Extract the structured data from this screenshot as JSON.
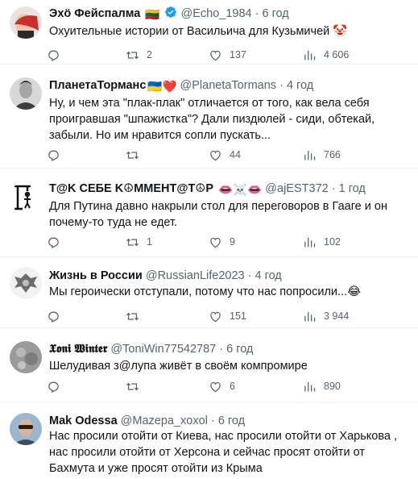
{
  "tweets": [
    {
      "name": "Эхӧ Фейспалма",
      "badges": "🇱🇹",
      "verified": true,
      "handle": "@Echo_1984",
      "dot": "·",
      "time": "6 год",
      "text": "Охуительные истории от Васильича для Кузьмичей 🤡",
      "replies": "",
      "retweets": "2",
      "likes": "137",
      "views": "4 606",
      "avatar": "facepalm-avatar"
    },
    {
      "name": "ПланетаТорманс",
      "badges": "🇺🇦❤️",
      "verified": false,
      "handle": "@PlanetaTormans",
      "dot": "·",
      "time": "4 год",
      "text": "Ну, и чем эта \"плак-плак\" отличается от того, как вела себя проигравшая \"шпажистка\"? Дали пиздюлей - сиди, обтекай, забыли. Но им нравится сопли пускать...",
      "replies": "",
      "retweets": "",
      "likes": "44",
      "views": "766",
      "avatar": "man-portrait-avatar"
    },
    {
      "name": "T@K CEБE K☮MMEHT@T☮P",
      "badges": "👄☠️👄",
      "verified": false,
      "handle": "@ajEST372",
      "dot": "·",
      "time": "1 год",
      "text": "Для Путина давно накрыли стол для переговоров в Гааге и он почему-то туда не едет.",
      "replies": "",
      "retweets": "1",
      "likes": "9",
      "views": "102",
      "avatar": "gallows-avatar"
    },
    {
      "name": "Жизнь в России",
      "badges": "",
      "verified": false,
      "handle": "@RussianLife2023",
      "dot": "·",
      "time": "4 год",
      "text": "Мы героически отступали, потому что нас попросили...😂",
      "replies": "",
      "retweets": "",
      "likes": "151",
      "views": "3 944",
      "avatar": "eagle-emblem-avatar"
    },
    {
      "name": "𝖃𝖔𝖓𝖎 𝖂𝖎𝖓𝖙𝖊𝖗",
      "badges": "",
      "verified": false,
      "handle": "@ToniWin77542787",
      "dot": "·",
      "time": "6 год",
      "text": "Шелудивая з@лупа живёт в своём  компромире",
      "replies": "",
      "retweets": "",
      "likes": "6",
      "views": "890",
      "avatar": "stone-avatar"
    },
    {
      "name": "Mak Odessa",
      "badges": "",
      "verified": false,
      "handle": "@Mazepa_xoxol",
      "dot": "·",
      "time": "6 год",
      "text": "Нас просили отойти от Киева, нас просили отойти от Харькова , нас просили отойти от Херсона и сейчас просят отойти от Бахмута и уже просят отойти из Крыма",
      "replies": "",
      "retweets": "",
      "likes": "",
      "views": "",
      "avatar": "man-sunglasses-avatar"
    }
  ]
}
